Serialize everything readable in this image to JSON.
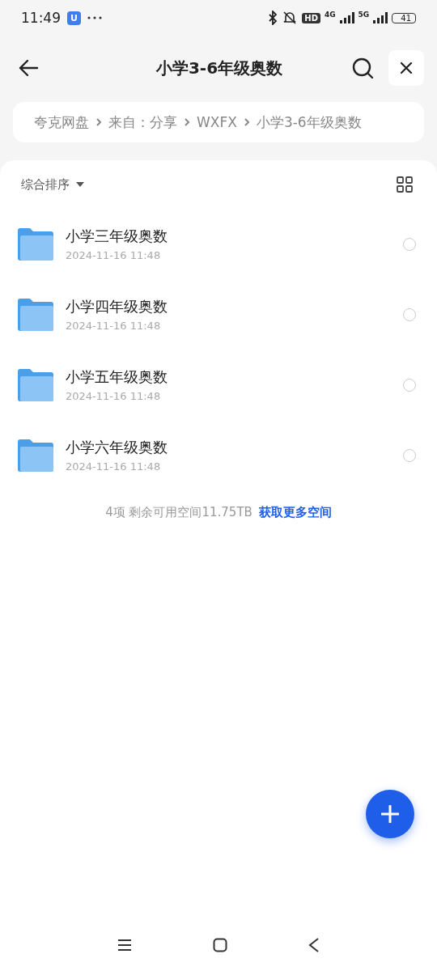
{
  "status_bar": {
    "time": "11:49",
    "app_badge": "U",
    "hd": "HD",
    "network_1": "4G",
    "network_2": "5G",
    "battery": "41"
  },
  "header": {
    "title": "小学3-6年级奥数"
  },
  "breadcrumb": [
    "夸克网盘",
    "来自：分享",
    "WXFX",
    "小学3-6年级奥数"
  ],
  "toolbar": {
    "sort_label": "综合排序"
  },
  "files": [
    {
      "name": "小学三年级奥数",
      "date": "2024-11-16 11:48",
      "selected": false
    },
    {
      "name": "小学四年级奥数",
      "date": "2024-11-16 11:48",
      "selected": false
    },
    {
      "name": "小学五年级奥数",
      "date": "2024-11-16 11:48",
      "selected": false
    },
    {
      "name": "小学六年级奥数",
      "date": "2024-11-16 11:48",
      "selected": false
    }
  ],
  "footer": {
    "summary": "4项 剩余可用空间11.75TB",
    "link": "获取更多空间"
  }
}
